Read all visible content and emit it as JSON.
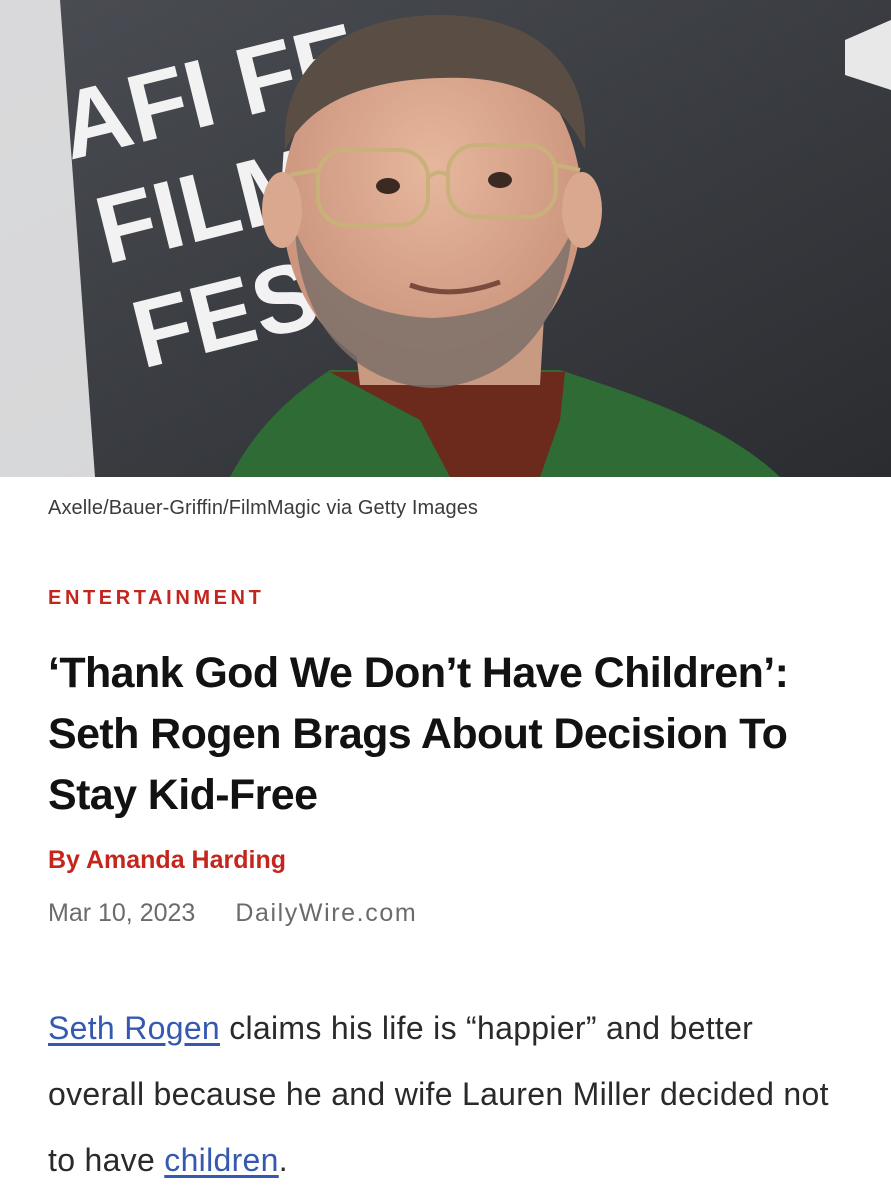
{
  "hero": {
    "backdrop_lines": [
      "AFI FE",
      "FILM",
      "FEST"
    ]
  },
  "caption": "Axelle/Bauer-Griffin/FilmMagic via Getty Images",
  "category": "ENTERTAINMENT",
  "headline": "‘Thank God We Don’t Have Children’: Seth Rogen Brags About Decision To Stay Kid-Free",
  "byline": "By Amanda Harding",
  "meta": {
    "date": "Mar 10, 2023",
    "source": "DailyWire.com"
  },
  "body": {
    "link1": "Seth Rogen",
    "text1": " claims his life is “happier” and better overall because he and wife Lauren Miller decided not to have ",
    "link2": "children",
    "text2": "."
  },
  "colors": {
    "accent": "#c4261d",
    "link": "#3559b0",
    "backdrop": "#3a3c42",
    "jacket": "#2e6b35",
    "shirt": "#6b2a1c"
  }
}
